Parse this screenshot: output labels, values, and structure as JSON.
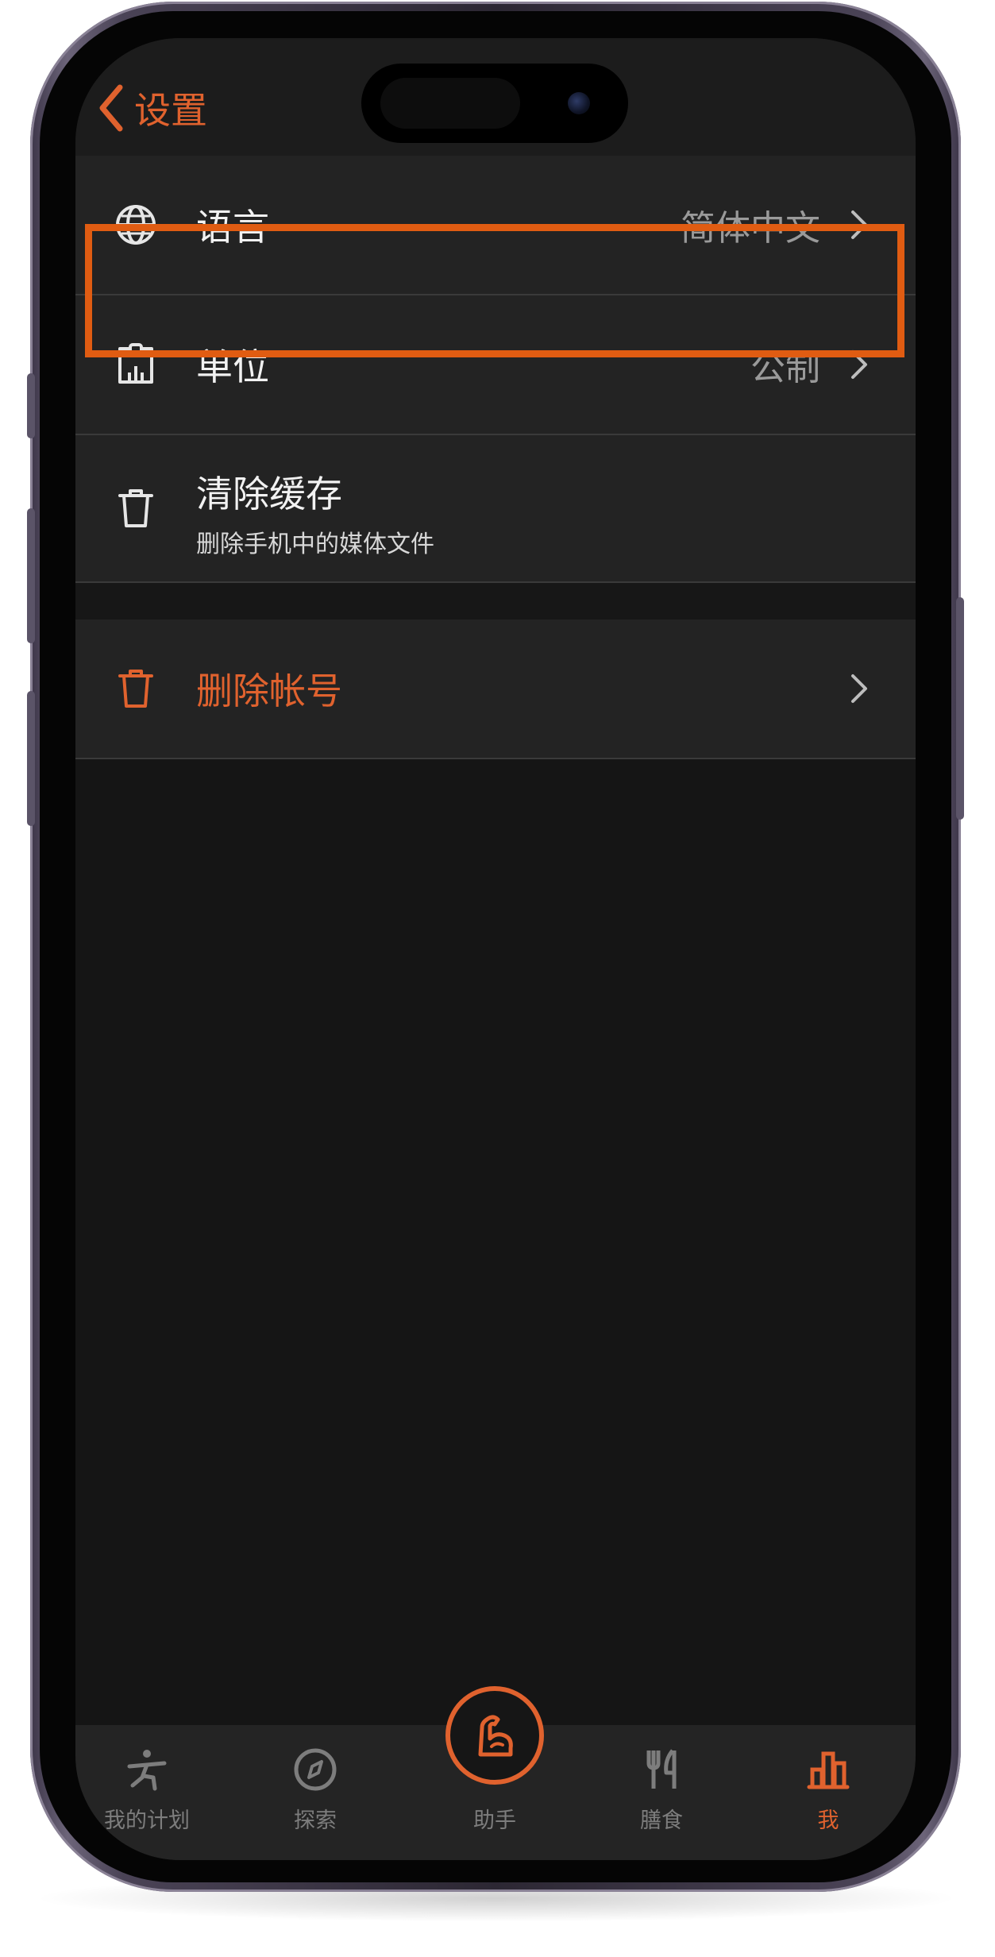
{
  "header": {
    "back_label": "设置"
  },
  "settings": {
    "language": {
      "label": "语言",
      "value": "简体中文"
    },
    "units": {
      "label": "单位",
      "value": "公制"
    },
    "cache": {
      "label": "清除缓存",
      "subtitle": "删除手机中的媒体文件"
    },
    "delete_account": {
      "label": "删除帐号"
    }
  },
  "tabs": [
    {
      "label": "我的计划",
      "icon": "exercise-person-icon"
    },
    {
      "label": "探索",
      "icon": "compass-icon"
    },
    {
      "label": "助手",
      "icon": "flexed-arm-icon"
    },
    {
      "label": "膳食",
      "icon": "fork-knife-icon"
    },
    {
      "label": "我",
      "icon": "bar-chart-icon"
    }
  ],
  "colors": {
    "accent": "#e0622e",
    "highlight_border": "#e05c12",
    "row_background": "#232323",
    "screen_background": "#151515"
  }
}
